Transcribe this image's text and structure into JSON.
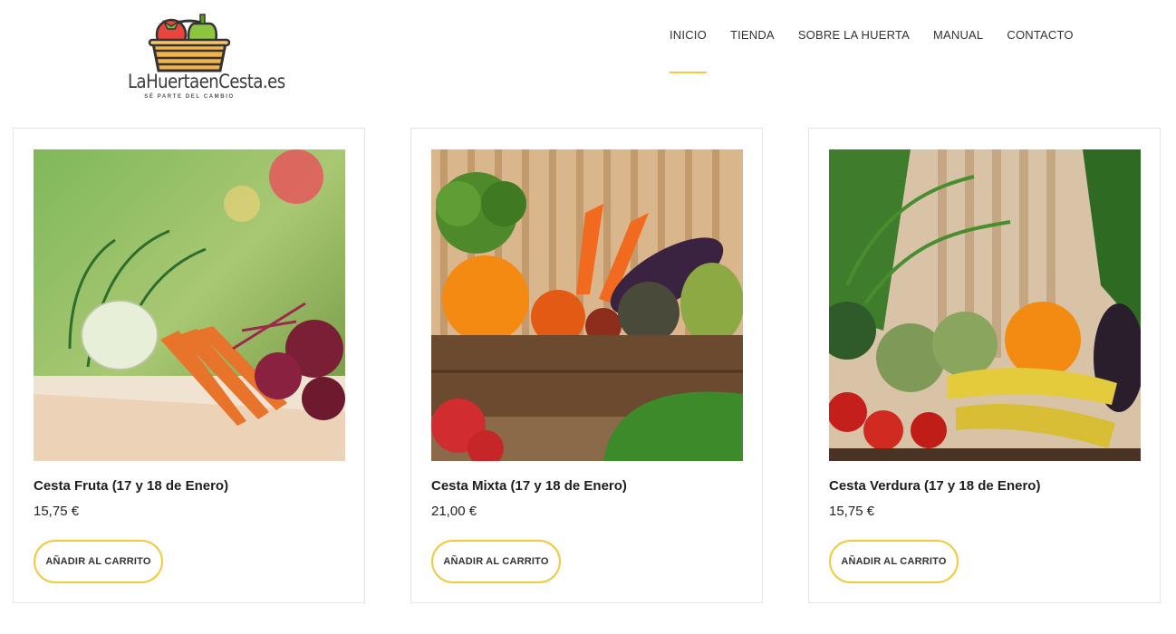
{
  "header": {
    "logo_text": "LaHuertaenCesta.es",
    "logo_tagline": "SÉ PARTE DEL CAMBIO",
    "nav": [
      {
        "label": "INICIO",
        "active": true
      },
      {
        "label": "TIENDA"
      },
      {
        "label": "SOBRE LA HUERTA"
      },
      {
        "label": "MANUAL"
      },
      {
        "label": "CONTACTO"
      }
    ]
  },
  "products": [
    {
      "title": "Cesta Fruta (17 y 18 de Enero)",
      "price": "15,75 €",
      "button": "AÑADIR AL CARRITO",
      "image": "vegetable-basket-photo"
    },
    {
      "title": "Cesta Mixta (17 y 18 de Enero)",
      "price": "21,00 €",
      "button": "AÑADIR AL CARRITO",
      "image": "mixed-box-photo"
    },
    {
      "title": "Cesta Verdura (17 y 18 de Enero)",
      "price": "15,75 €",
      "button": "AÑADIR AL CARRITO",
      "image": "fruit-veg-photo"
    }
  ],
  "colors": {
    "accent": "#f0c93c",
    "border": "#e3e3e3"
  }
}
